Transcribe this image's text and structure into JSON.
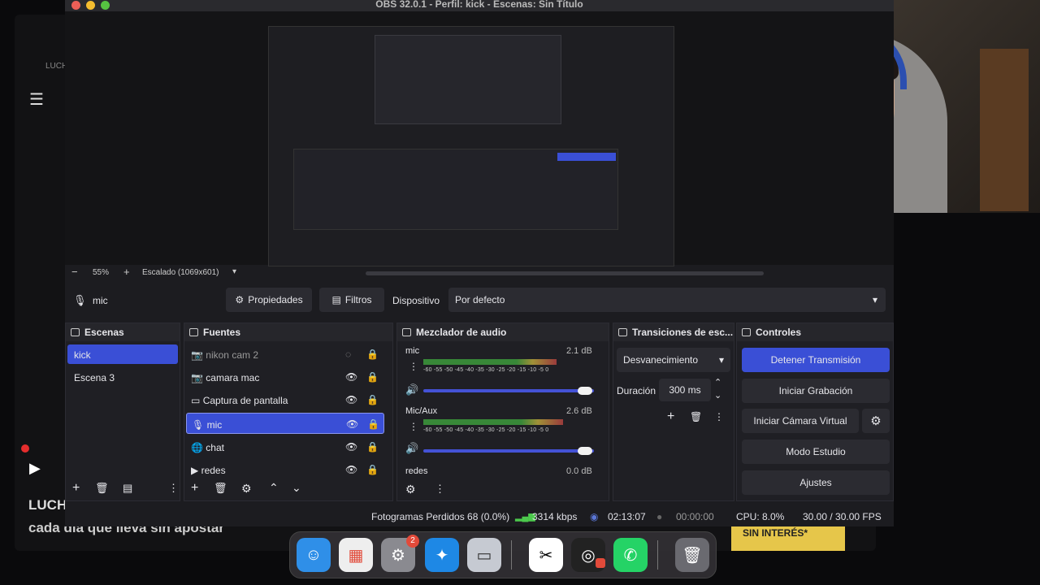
{
  "window": {
    "title": "OBS 32.0.1 - Perfil: kick - Escenas: Sin Título"
  },
  "background": {
    "luch_small": "LUCH",
    "title_line1": "LUCH",
    "title_line2": "cada dia que lleva sin apostar",
    "banner_text": "SIN INTERÉS*"
  },
  "preview": {
    "zoom_minus": "−",
    "zoom_value": "55%",
    "zoom_plus": "+",
    "scale_label": "Escalado (1069x601)"
  },
  "source_toolbar": {
    "selected_source": "mic",
    "properties": "Propiedades",
    "filters": "Filtros",
    "device_label": "Dispositivo",
    "device_value": "Por defecto"
  },
  "scenes": {
    "title": "Escenas",
    "items": [
      "kick",
      "Escena 3"
    ]
  },
  "sources": {
    "title": "Fuentes",
    "items": [
      "nikon cam 2",
      "camara mac",
      "Captura de pantalla",
      "mic",
      "chat",
      "redes"
    ]
  },
  "mixer": {
    "title": "Mezclador de audio",
    "channels": [
      {
        "name": "mic",
        "db": "2.1 dB",
        "level": 0.78
      },
      {
        "name": "Mic/Aux",
        "db": "2.6 dB",
        "level": 0.82
      },
      {
        "name": "redes",
        "db": "0.0 dB"
      }
    ],
    "scale": "-60 -55 -50 -45 -40 -35 -30 -25 -20 -15 -10 -5 0"
  },
  "transitions": {
    "title": "Transiciones de esc...",
    "type": "Desvanecimiento",
    "duration_label": "Duración",
    "duration_value": "300 ms"
  },
  "controls": {
    "title": "Controles",
    "stop_stream": "Detener Transmisión",
    "start_recording": "Iniciar Grabación",
    "start_virtual_cam": "Iniciar Cámara Virtual",
    "studio_mode": "Modo Estudio",
    "settings": "Ajustes"
  },
  "status": {
    "dropped_frames": "Fotogramas Perdidos 68 (0.0%)",
    "bitrate": "3314 kbps",
    "stream_time": "02:13:07",
    "rec_time": "00:00:00",
    "cpu": "CPU: 8.0%",
    "fps": "30.00 / 30.00 FPS"
  },
  "dock": {
    "settings_badge": "2"
  },
  "colors": {
    "accent": "#3a4fd6",
    "red": "#e24a3a",
    "yellow": "#f2c94c",
    "green": "#4cc94c"
  }
}
